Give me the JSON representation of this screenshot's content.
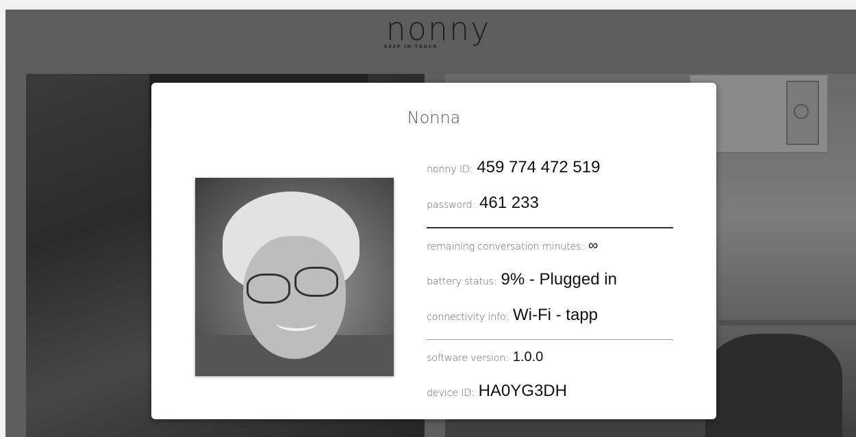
{
  "header": {
    "logo_text": "nonny",
    "logo_tagline": "KEEP IN TOUCH"
  },
  "modal": {
    "title": "Nonna",
    "photo_alt": "Nonna",
    "fields": {
      "nonny_id_label": "nonny ID:",
      "nonny_id_value": "459 774 472 519",
      "password_label": "password:",
      "password_value": "461 233",
      "minutes_label": "remaining conversation minutes:",
      "minutes_value": "∞",
      "battery_label": "battery status:",
      "battery_value": "9% - Plugged in",
      "connectivity_label": "connectivity info:",
      "connectivity_value": "Wi-Fi - tapp",
      "software_label": "software version:",
      "software_value": "1.0.0",
      "device_label": "device ID:",
      "device_value": "HA0YG3DH"
    }
  }
}
